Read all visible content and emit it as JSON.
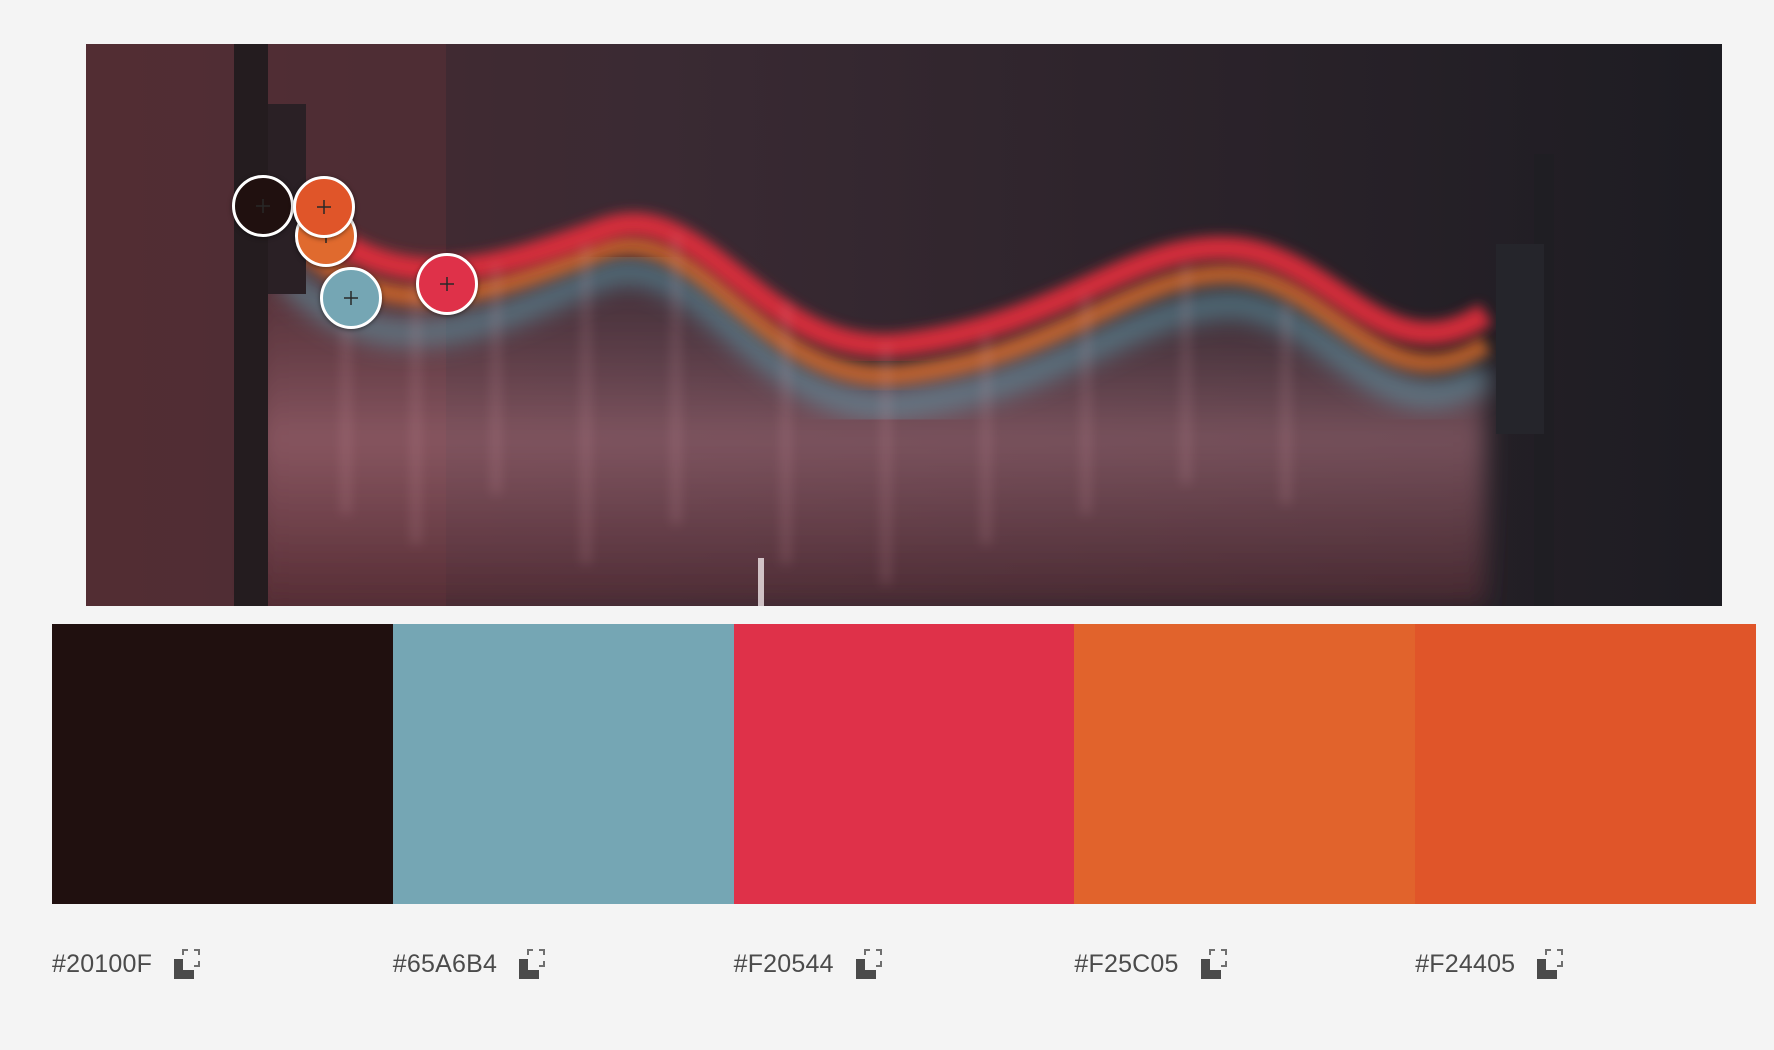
{
  "image": {
    "description_icon": "source-photo"
  },
  "pickers": [
    {
      "color": "#20100F"
    },
    {
      "color": "#E06A2E"
    },
    {
      "color": "#F25C05"
    },
    {
      "color": "#65A6B4"
    },
    {
      "color": "#F20544"
    }
  ],
  "palette": [
    {
      "hex": "#20100F",
      "color": "#20100F"
    },
    {
      "hex": "#65A6B4",
      "color": "#75A6B4"
    },
    {
      "hex": "#F20544",
      "color": "#DF3149"
    },
    {
      "hex": "#F25C05",
      "color": "#E1632C"
    },
    {
      "hex": "#F24405",
      "color": "#E05529"
    }
  ],
  "icons": {
    "copy": "copy-icon"
  }
}
